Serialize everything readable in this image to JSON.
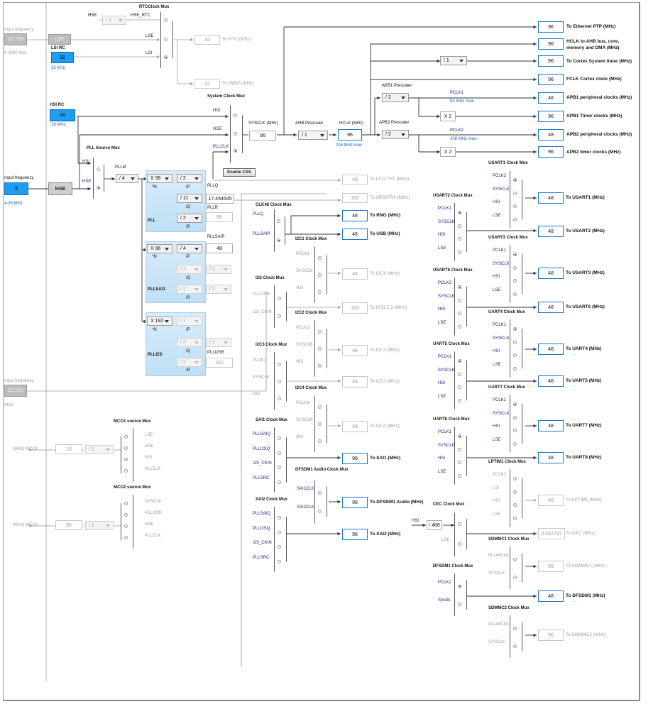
{
  "inputs": {
    "lse_label": "Input frequency",
    "lse_value": "32.768",
    "lse_range": "0-1000 KHz",
    "lse_btn": "LSE",
    "lsi_title": "LSI RC",
    "lsi_value": "32",
    "lsi_unit": "32 KHz",
    "hsi_title": "HSI RC",
    "hsi_value": "16",
    "hsi_unit": "16 MHz",
    "hse_label": "Input frequency",
    "hse_value": "8",
    "hse_range": "4-26 MHz",
    "hse_btn": "HSE",
    "ext_label": "Input frequency",
    "ext_value": "12.288",
    "ext_unit": "MHz"
  },
  "rtc": {
    "title": "RTCClock Mux",
    "hse_label": "HSE",
    "hse_rtc": "HSE_RTC",
    "div": "/ 2",
    "in_lse": "LSE",
    "in_lsi": "LSI",
    "out_value": "32",
    "out_label": "To RTC (KHz)",
    "iwdg_value": "32",
    "iwdg_label": "To IWDG (KHz)"
  },
  "sysmux": {
    "title": "System Clock Mux",
    "hsi": "HSI",
    "hse": "HSE",
    "pllclk": "PLLCLK",
    "enable_css": "Enable CSS"
  },
  "sysclk": {
    "label": "SYSCLK (MHz)",
    "value": "96"
  },
  "ahb": {
    "label": "AHB Prescaler",
    "value": "/ 1"
  },
  "hclk": {
    "label": "HCLK (MHz)",
    "value": "96",
    "max": "216 MHz max"
  },
  "apb1": {
    "label": "APB1 Prescaler",
    "value": "/ 2",
    "pclk": "PCLK1",
    "max": "54 MHz max",
    "x2": "X 2"
  },
  "apb2": {
    "label": "APB2 Prescaler",
    "value": "/ 2",
    "pclk": "PCLK2",
    "max": "108 MHz max",
    "x2": "X 2"
  },
  "systimer_div": "/ 1",
  "outputs": [
    {
      "value": "96",
      "label": "To Ethernet PTP (MHz)"
    },
    {
      "value": "96",
      "label": "HCLK to AHB bus, core,",
      "label2": "memory and DMA (MHz)"
    },
    {
      "value": "96",
      "label": "To Cortex System timer (MHz)"
    },
    {
      "value": "96",
      "label": "FCLK Cortex clock (MHz)"
    },
    {
      "value": "48",
      "label": "APB1 peripheral clocks (MHz)"
    },
    {
      "value": "96",
      "label": "APB1 Timer clocks (MHz)"
    },
    {
      "value": "48",
      "label": "APB2 peripheral clocks (MHz)"
    },
    {
      "value": "96",
      "label": "APB2 timer clocks (MHz)"
    }
  ],
  "pllsrc": {
    "title": "PLL Source Mux",
    "hsi": "HSI",
    "hse": "HSE"
  },
  "pllm": {
    "label": "PLLM",
    "value": "/ 4"
  },
  "pll": {
    "name": "PLL",
    "n": "X 96",
    "n_lbl": "*N",
    "p": "/ 2",
    "p_lbl": "/P",
    "q": "/ 11",
    "q_lbl": "/Q",
    "r": "/ 2",
    "r_lbl": "/R",
    "pllq_lbl": "PLLQ",
    "pllq_val": "17.454545",
    "pllr_lbl": "PLLR",
    "pllr_val": "96"
  },
  "pllsai": {
    "name": "PLLSAI1",
    "n": "X 96",
    "n_lbl": "*N",
    "p": "/ 4",
    "p_lbl": "/P",
    "q": "/ 2",
    "q_lbl": "/Q",
    "q2": "/ 1",
    "r": "/ 2",
    "r_lbl": "/R",
    "r2": "/ 2",
    "pllsaip_lbl": "PLLSAIP",
    "pllsaip_val": "48"
  },
  "plli2s": {
    "name": "PLLI2S",
    "n": "X 192",
    "n_lbl": "*N",
    "p": "/ 2",
    "p_lbl": "/P",
    "q": "/ 2",
    "q_lbl": "/Q",
    "q2": "/ 1",
    "r": "/ 2",
    "r_lbl": "/R",
    "plli2sr_lbl": "PLLI2SR",
    "plli2sr_val": "192"
  },
  "lcd": {
    "value": "48",
    "label": "To LCD-TFT (MHz)"
  },
  "spdif": {
    "value": "192",
    "label": "To SPDIFRX (MHz)"
  },
  "clk48": {
    "title": "CLK48 Clock Mux",
    "in1": "PLLQ",
    "in2": "PLLSAIP",
    "rng_val": "48",
    "rng_lbl": "To RNG (MHz)",
    "usb_val": "48",
    "usb_lbl": "To USB (MHz)"
  },
  "i2c1": {
    "title": "I2C1 Clock Mux",
    "ins": [
      "PCLK1",
      "SYSCLK",
      "HSI"
    ],
    "value": "48",
    "label": "To I2C1 (MHz)"
  },
  "i2s": {
    "title": "I2S Clock Mux",
    "ins": [
      "PLLI2SR",
      "I2S_CKIN"
    ],
    "value": "192",
    "label": "To I2S1,2,3 (MHz)"
  },
  "i2c2": {
    "title": "I2C2 Clock Mux",
    "ins": [
      "PCLK1",
      "SYSCLK",
      "HSI"
    ],
    "value": "48",
    "label": "To I2C2 (MHz)"
  },
  "i2c3": {
    "title": "I2C3 Clock Mux",
    "ins": [
      "PCLK1",
      "SYSCLK",
      "HSI"
    ],
    "value": "48",
    "label": "To I2C3 (MHz)"
  },
  "i2c4": {
    "title": "I2C4 Clock Mux",
    "ins": [
      "PCLK1",
      "SYSCLK",
      "HSI"
    ],
    "value": "48",
    "label": "To I2C4 (MHz)"
  },
  "sai1": {
    "title": "SAI1 Clock Mux",
    "ins": [
      "PLLSAIQ",
      "PLLI2SQ",
      "I2S_CKIN",
      "PLLSRC"
    ],
    "value": "96",
    "label": "To SAI1 (MHz)"
  },
  "dfsdm_audio": {
    "title": "DFSDM1 Audio Clock Mux",
    "ins": [
      "SAI1CLK",
      "SAI2CLK"
    ],
    "value": "96",
    "label": "To DFSDM1 Audio (MHz)"
  },
  "sai2": {
    "title": "SAI2 Clock Mux",
    "ins": [
      "PLLSAIQ",
      "PLLI2SQ",
      "I2S_CKIN",
      "PLLSRC"
    ],
    "value": "96",
    "label": "To SAI2 (MHz)"
  },
  "usart1": {
    "title": "USART1 Clock Mux",
    "ins": [
      "PCLK2",
      "SYSCLK",
      "HSI",
      "LSE"
    ],
    "value": "48",
    "label": "To USART1 (MHz)"
  },
  "usart2": {
    "title": "USART2 Clock Mux",
    "ins": [
      "PCLK1",
      "SYSCLK",
      "HSI",
      "LSE"
    ],
    "value": "48",
    "label": "To USART2 (MHz)"
  },
  "usart3": {
    "title": "USART3 Clock Mux",
    "ins": [
      "PCLK1",
      "SYSCLK",
      "HSI",
      "LSE"
    ],
    "value": "48",
    "label": "To USART3 (MHz)"
  },
  "usart6": {
    "title": "USART6 Clock Mux",
    "ins": [
      "PCLK2",
      "SYSCLK",
      "HSI",
      "LSE"
    ],
    "value": "48",
    "label": "To USART6 (MHz)"
  },
  "uart4": {
    "title": "UART4 Clock Mux",
    "ins": [
      "PCLK1",
      "SYSCLK",
      "HSI",
      "LSE"
    ],
    "value": "48",
    "label": "To UART4 (MHz)"
  },
  "uart5": {
    "title": "UART5 Clock Mux",
    "ins": [
      "PCLK1",
      "SYSCLK",
      "HSI",
      "LSE"
    ],
    "value": "48",
    "label": "To UART5 (MHz)"
  },
  "uart7": {
    "title": "UART7 Clock Mux",
    "ins": [
      "PCLK1",
      "SYSCLK",
      "HSI",
      "LSE"
    ],
    "value": "48",
    "label": "To UART7 (MHz)"
  },
  "uart8": {
    "title": "UART8 Clock Mux",
    "ins": [
      "PCLK1",
      "SYSCLK",
      "HSI",
      "LSE"
    ],
    "value": "48",
    "label": "To UART8 (MHz)"
  },
  "lptim1": {
    "title": "LPTIM1 Clock Mux",
    "ins": [
      "PCLK1",
      "LSI",
      "HSI",
      "LSE"
    ],
    "value": "48",
    "label": "To LPTIM1 (MHz)"
  },
  "cec": {
    "title": "CEC Clock Mux",
    "hsi": "HSI",
    "div": "/ 488",
    "ins": [
      "LSE"
    ],
    "value": "0.032787",
    "label": "To CEC (MHz)"
  },
  "sdmmc1": {
    "title": "SDMMC1 Clock Mux",
    "ins": [
      "PLL48CLK",
      "SYSCLK"
    ],
    "value": "96",
    "label": "To SDMMC1 (MHz)"
  },
  "dfsdm1": {
    "title": "DFSDM1 Clock Mux",
    "ins": [
      "PCLK2",
      "Sysclk"
    ],
    "value": "48",
    "label": "To DFSDM1 (MHz)"
  },
  "sdmmc2": {
    "title": "SDMMC2 Clock Mux",
    "ins": [
      "PLL48CLK",
      "SYSCLK"
    ],
    "value": "96",
    "label": "To SDMMC2 (MHz)"
  },
  "mco1": {
    "title": "MCO1 source Mux",
    "ins": [
      "LSE",
      "HSE",
      "HSI",
      "PLLCLK"
    ],
    "div": "/ 1",
    "value": "16",
    "label": "(MHz) MCO1"
  },
  "mco2": {
    "title": "MCO2 source Mux",
    "ins": [
      "SYSCLK",
      "PLLI2SR",
      "HSE",
      "PLLCLK"
    ],
    "div": "/ 1",
    "value": "96",
    "label": "(MHz) MCO2"
  }
}
